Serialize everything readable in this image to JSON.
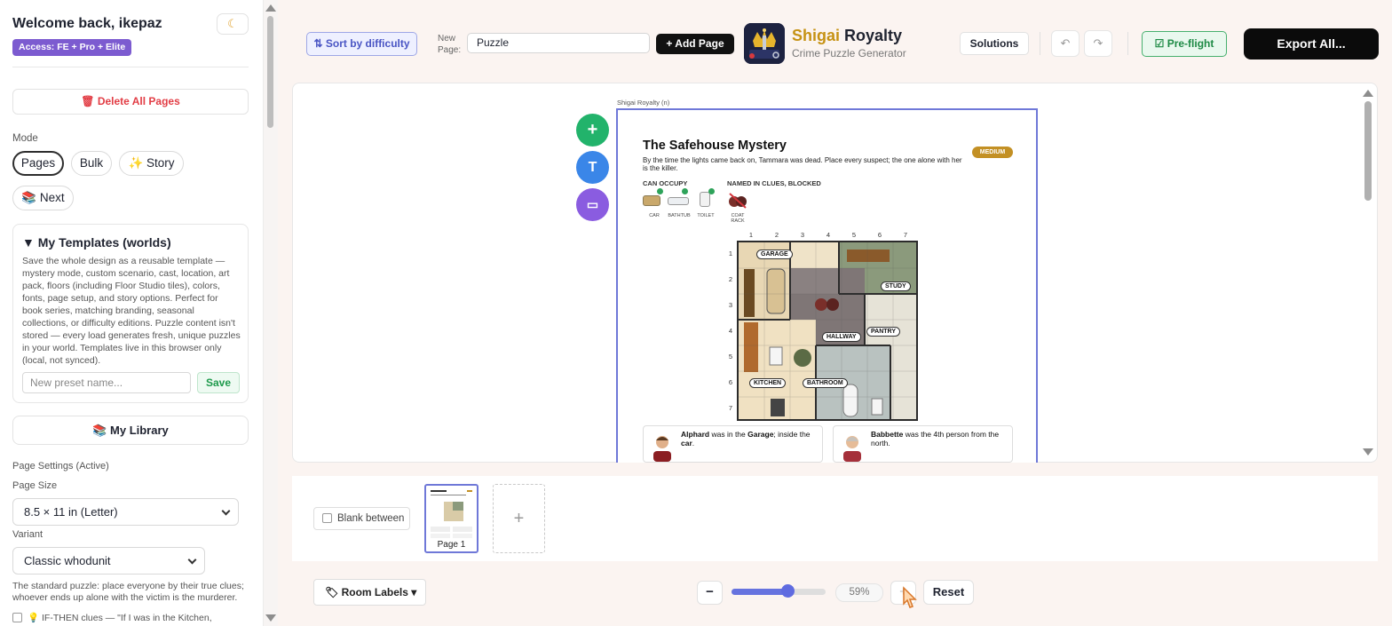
{
  "sidebar": {
    "welcome": "Welcome back, ikepaz",
    "access_badge": "Access: FE + Pro + Elite",
    "delete_all": "🗑 Delete All Pages",
    "mode_label": "Mode",
    "modes": [
      "Pages",
      "Bulk",
      "✨ Story",
      "📚 Next"
    ],
    "active_mode": "Pages",
    "templates": {
      "title": "▼ My Templates (worlds)",
      "description": "Save the whole design as a reusable template — mystery mode, custom scenario, cast, location, art pack, floors (including Floor Studio tiles), colors, fonts, page setup, and story options. Perfect for book series, matching branding, seasonal collections, or difficulty editions. Puzzle content isn't stored — every load generates fresh, unique puzzles in your world. Templates live in this browser only (local, not synced).",
      "preset_placeholder": "New preset name...",
      "save_label": "Save"
    },
    "library_label": "📚 My Library",
    "page_settings_label": "Page Settings (Active)",
    "page_size_label": "Page Size",
    "page_size_value": "8.5 × 11 in (Letter)",
    "variant_label": "Variant",
    "variant_value": "Classic whodunit",
    "variant_desc": "The standard puzzle: place everyone by their true clues; whoever ends up alone with the victim is the murderer.",
    "ifthen_label": "💡 IF-THEN clues — \"If I was in the Kitchen,"
  },
  "toolbar": {
    "sort_label": "⇅ Sort by difficulty",
    "new_page_label": "New Page:",
    "new_page_value": "Puzzle",
    "add_page": "+ Add Page",
    "brand_gold": "Shigai",
    "brand_rest": " Royalty",
    "brand_sub": "Crime Puzzle Generator",
    "solutions": "Solutions",
    "undo_icon": "↶",
    "redo_icon": "↷",
    "preflight": "☑ Pre-flight",
    "export": "Export All..."
  },
  "canvas": {
    "fab_add": "+",
    "fab_text": "T",
    "fab_image": "▭",
    "page_caption": "Shigai Royalty (n)",
    "puzzle": {
      "title": "The Safehouse Mystery",
      "difficulty": "MEDIUM",
      "intro": "By the time the lights came back on, Tammara was dead. Place every suspect; the one alone with her is the killer.",
      "can_occupy_label": "CAN OCCUPY",
      "blocked_label": "NAMED IN CLUES, BLOCKED",
      "occupy_items": [
        "CAR",
        "BATHTUB",
        "TOILET"
      ],
      "blocked_items": [
        "COAT RACK"
      ],
      "col_labels": [
        "1",
        "2",
        "3",
        "4",
        "5",
        "6",
        "7"
      ],
      "row_labels": [
        "1",
        "2",
        "3",
        "4",
        "5",
        "6",
        "7"
      ],
      "rooms": [
        "GARAGE",
        "STUDY",
        "PANTRY",
        "HALLWAY",
        "KITCHEN",
        "BATHROOM"
      ],
      "clues": [
        {
          "name": "Alphard",
          "pre": " was in the ",
          "place": "Garage",
          "post": "; inside the ",
          "obj": "car",
          "end": "."
        },
        {
          "name": "Babbette",
          "text": " was the 4th person from the north."
        }
      ]
    }
  },
  "strip": {
    "blank_between": "Blank between",
    "page_label": "Page 1",
    "add_page_icon": "+"
  },
  "bottom": {
    "room_labels": "🏷 Room Labels ▾",
    "zoom_minus": "−",
    "zoom_plus": "+",
    "zoom_value": "59%",
    "zoom_fraction": 0.59,
    "reset": "Reset"
  },
  "colors": {
    "accent": "#6673df",
    "brand_gold": "#c69214",
    "badge_purple": "#7c5bd0",
    "danger": "#e23d45",
    "success": "#1e8a45"
  }
}
